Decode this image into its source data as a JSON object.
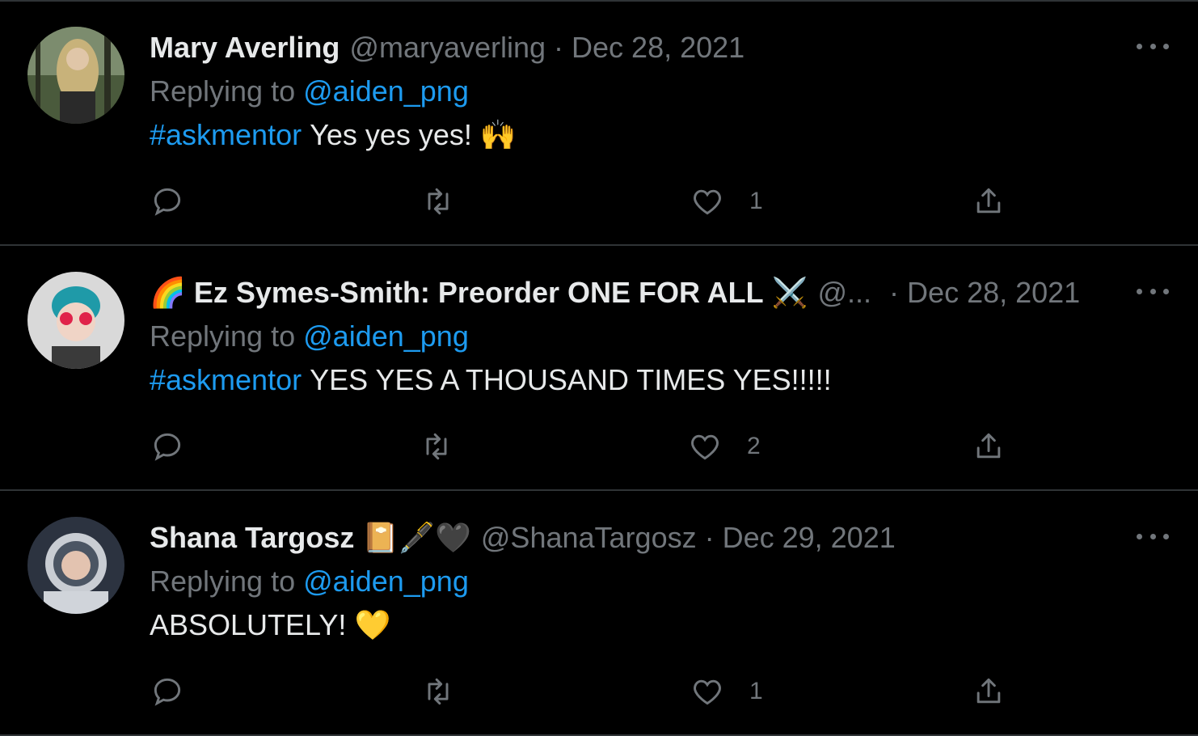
{
  "tweets": [
    {
      "name": "Mary Averling",
      "handle": "@maryaverling",
      "separator": "·",
      "date": "Dec 28, 2021",
      "replying_prefix": "Replying to",
      "replying_to": "@aiden_png",
      "hashtag": "#askmentor",
      "body": "Yes yes yes!",
      "body_emoji": "🙌",
      "likes": "1"
    },
    {
      "name_emoji": "🌈",
      "name": "Ez Symes-Smith: Preorder ONE FOR ALL",
      "name_emoji_after": "⚔️",
      "handle": "@...",
      "separator": "·",
      "date": "Dec 28, 2021",
      "replying_prefix": "Replying to",
      "replying_to": "@aiden_png",
      "hashtag": "#askmentor",
      "body": "YES YES A THOUSAND TIMES YES!!!!!",
      "likes": "2"
    },
    {
      "name": "Shana Targosz",
      "name_emoji_after": "📔🖋️🖤",
      "handle": "@ShanaTargosz",
      "separator": "·",
      "date": "Dec 29, 2021",
      "replying_prefix": "Replying to",
      "replying_to": "@aiden_png",
      "body": "ABSOLUTELY!",
      "body_emoji": "💛",
      "likes": "1"
    }
  ],
  "icons": [
    "reply-icon",
    "retweet-icon",
    "like-icon",
    "share-icon",
    "more-icon"
  ],
  "colors": {
    "background": "#000000",
    "text": "#e7e9ea",
    "muted": "#71767b",
    "link": "#1d9bf0",
    "divider": "#2f3336"
  }
}
